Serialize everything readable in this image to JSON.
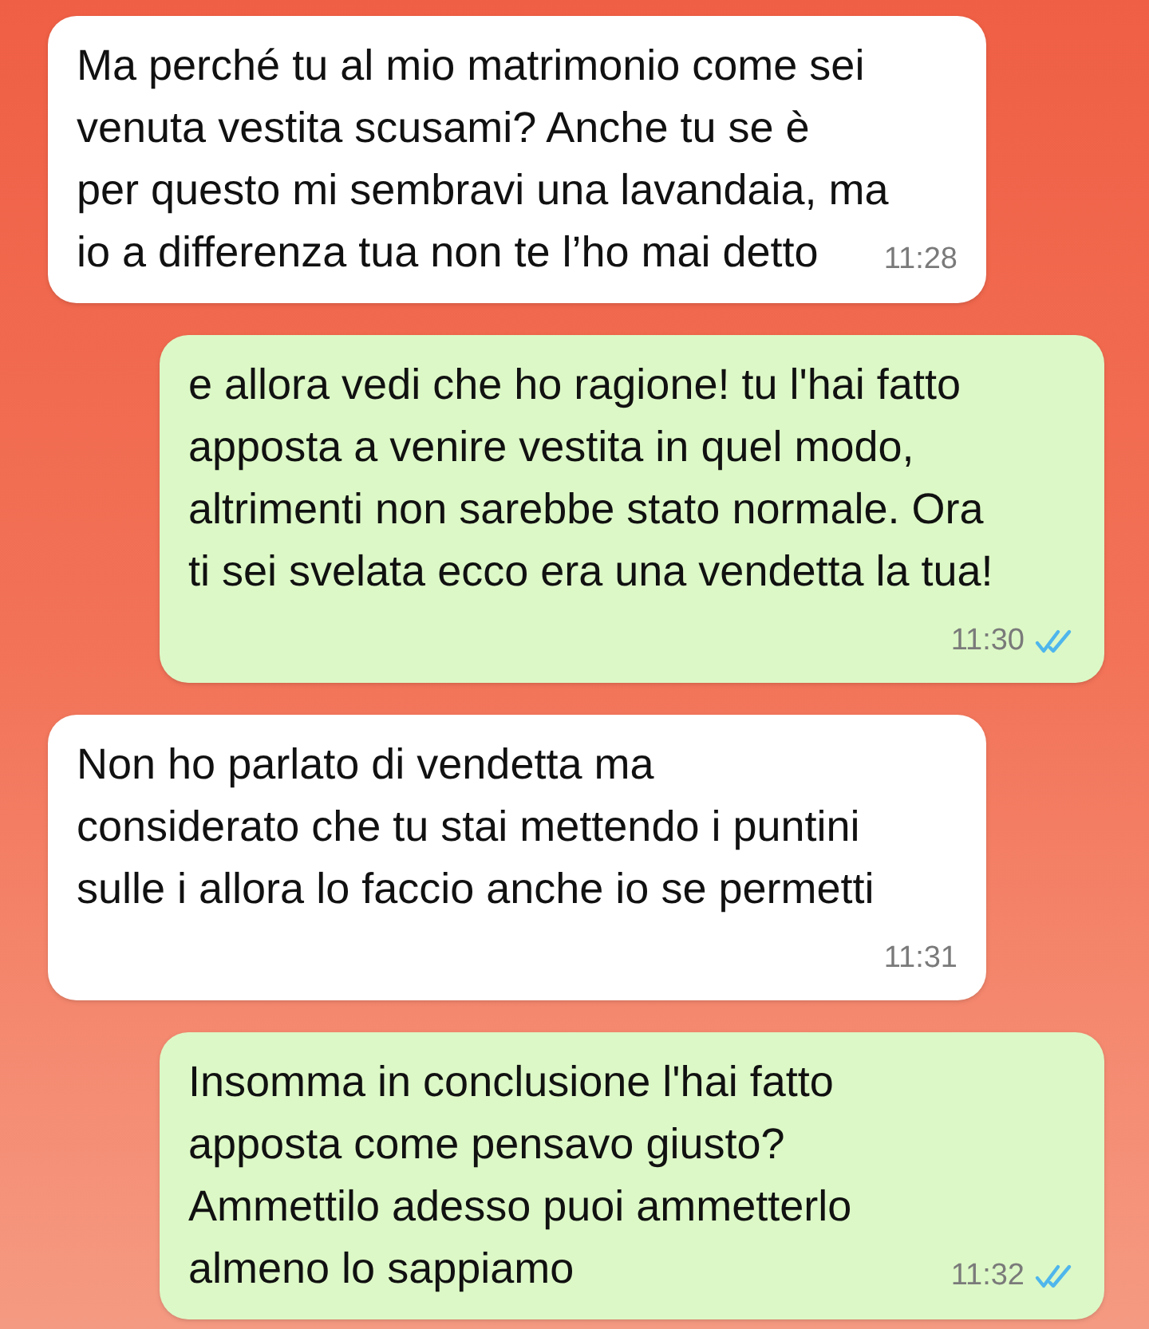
{
  "messages": [
    {
      "kind": "incoming",
      "text": "Ma perché tu al mio matrimonio come sei\nvenuta vestita scusami? Anche tu se è\nper questo mi sembravi una lavandaia, ma\nio a differenza tua non te l’ho mai detto",
      "time": "11:28"
    },
    {
      "kind": "outgoing",
      "text": "e allora vedi che ho ragione! tu l'hai fatto\napposta a venire vestita in quel modo,\naltrimenti non sarebbe stato normale. Ora\nti sei svelata ecco era una vendetta la tua!",
      "time": "11:30",
      "read": true
    },
    {
      "kind": "incoming",
      "text": "Non ho parlato di vendetta ma\nconsiderato che tu stai mettendo i puntini\nsulle i allora lo faccio anche io se permetti",
      "time": "11:31"
    },
    {
      "kind": "outgoing",
      "text": "Insomma in conclusione l'hai fatto\napposta come pensavo giusto?\nAmmettilo adesso puoi ammetterlo\nalmeno lo sappiamo",
      "time": "11:32",
      "read": true
    }
  ]
}
